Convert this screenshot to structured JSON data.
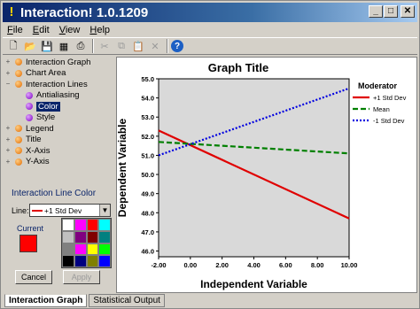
{
  "window": {
    "title": "Interaction!  1.0.1209"
  },
  "menu": [
    {
      "label": "File"
    },
    {
      "label": "Edit"
    },
    {
      "label": "View"
    },
    {
      "label": "Help"
    }
  ],
  "toolbar": [
    {
      "icon": "new-file-icon",
      "enabled": true
    },
    {
      "icon": "open-folder-icon",
      "enabled": true
    },
    {
      "icon": "save-icon",
      "enabled": true
    },
    {
      "icon": "chart-icon",
      "enabled": true
    },
    {
      "icon": "print-icon",
      "enabled": true
    },
    {
      "icon": "cut-icon",
      "enabled": false
    },
    {
      "icon": "copy-icon",
      "enabled": false
    },
    {
      "icon": "paste-icon",
      "enabled": false
    },
    {
      "icon": "delete-icon",
      "enabled": false
    },
    {
      "icon": "help-icon",
      "enabled": true
    }
  ],
  "tree": [
    {
      "label": "Interaction Graph",
      "level": 0,
      "expand": "+",
      "dot": "orange"
    },
    {
      "label": "Chart Area",
      "level": 0,
      "expand": "+",
      "dot": "orange"
    },
    {
      "label": "Interaction Lines",
      "level": 0,
      "expand": "−",
      "dot": "orange"
    },
    {
      "label": "Antialiasing",
      "level": 1,
      "dot": "purple"
    },
    {
      "label": "Color",
      "level": 1,
      "dot": "purple",
      "selected": true
    },
    {
      "label": "Style",
      "level": 1,
      "dot": "purple"
    },
    {
      "label": "Legend",
      "level": 0,
      "expand": "+",
      "dot": "orange"
    },
    {
      "label": "Title",
      "level": 0,
      "expand": "+",
      "dot": "orange"
    },
    {
      "label": "X-Axis",
      "level": 0,
      "expand": "+",
      "dot": "orange"
    },
    {
      "label": "Y-Axis",
      "level": 0,
      "expand": "+",
      "dot": "orange"
    }
  ],
  "line_color_panel": {
    "title": "Interaction Line Color",
    "line_label": "Line:",
    "line_value": "+1 Std Dev",
    "current_label": "Current",
    "current_color": "#ff0000",
    "palette": [
      "#ffffff",
      "#ff00ff",
      "#ff0000",
      "#00ffff",
      "#c0c0c0",
      "#800080",
      "#800000",
      "#008080",
      "#808080",
      "#ff00ff",
      "#ffff00",
      "#00ff00",
      "#000000",
      "#000080",
      "#808000",
      "#0000ff"
    ],
    "cancel_label": "Cancel",
    "apply_label": "Apply"
  },
  "tabs": [
    {
      "label": "Interaction Graph",
      "active": true
    },
    {
      "label": "Statistical Output",
      "active": false
    }
  ],
  "chart_data": {
    "type": "line",
    "title": "Graph Title",
    "xlabel": "Independent Variable",
    "ylabel": "Dependent Variable",
    "x": [
      -2.0,
      10.0
    ],
    "xticks": [
      "-2.00",
      "0.00",
      "2.00",
      "4.00",
      "6.00",
      "8.00",
      "10.00"
    ],
    "yticks": [
      "46.0",
      "47.0",
      "48.0",
      "49.0",
      "50.0",
      "51.0",
      "52.0",
      "53.0",
      "54.0",
      "55.0"
    ],
    "xlim": [
      -2.0,
      10.0
    ],
    "ylim": [
      45.7,
      55.0
    ],
    "legend_title": "Moderator",
    "legend_position": "right",
    "background": "#d9d9d9",
    "series": [
      {
        "name": "+1 Std Dev",
        "values": [
          52.3,
          47.7
        ],
        "color": "#e00000",
        "style": "solid"
      },
      {
        "name": "Mean",
        "values": [
          51.7,
          51.1
        ],
        "color": "#008000",
        "style": "dashed"
      },
      {
        "name": "-1 Std Dev",
        "values": [
          51.0,
          54.5
        ],
        "color": "#0000e0",
        "style": "dotted"
      }
    ]
  }
}
